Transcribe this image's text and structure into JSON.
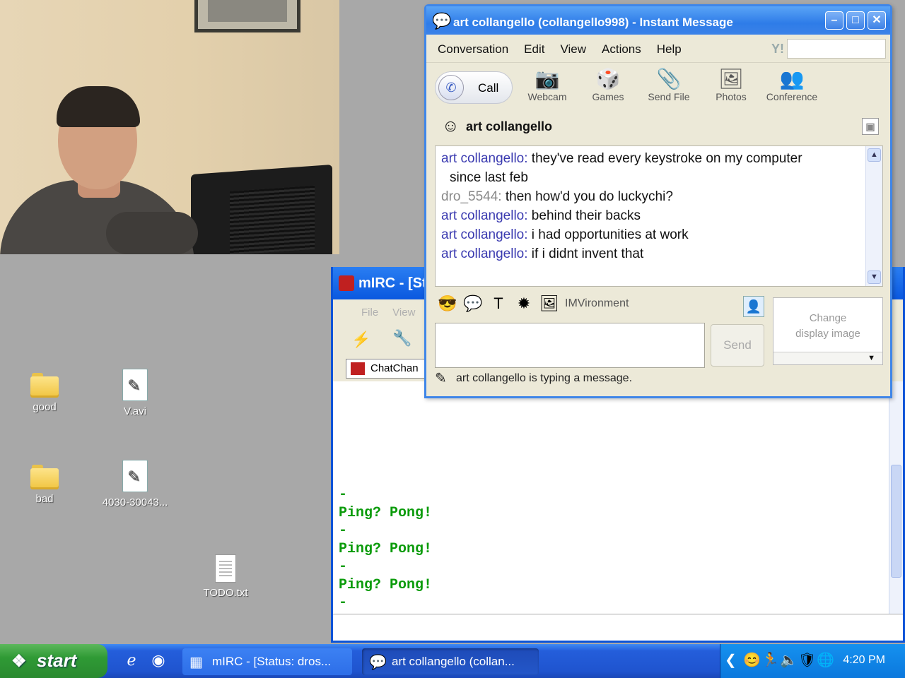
{
  "desktop": {
    "icons": [
      {
        "label": "good",
        "type": "folder"
      },
      {
        "label": "V.avi",
        "type": "video"
      },
      {
        "label": "bad",
        "type": "folder"
      },
      {
        "label": "4030-30043...",
        "type": "video"
      },
      {
        "label": "TODO.txt",
        "type": "text"
      }
    ]
  },
  "im": {
    "title": "art collangello (collangello998) - Instant Message",
    "menu": [
      "Conversation",
      "Edit",
      "View",
      "Actions",
      "Help"
    ],
    "call_label": "Call",
    "tools": [
      {
        "label": "Webcam",
        "icon": "webcam-icon"
      },
      {
        "label": "Games",
        "icon": "games-icon"
      },
      {
        "label": "Send File",
        "icon": "send-file-icon"
      },
      {
        "label": "Photos",
        "icon": "photos-icon"
      },
      {
        "label": "Conference",
        "icon": "conference-icon"
      }
    ],
    "contact_name": "art collangello",
    "messages": [
      {
        "sender": "art collangello:",
        "text": " they've read every keystroke on my computer",
        "cont": "since last feb",
        "own": false
      },
      {
        "sender": "dro_5544:",
        "text": " then how'd you do luckychi?",
        "cont": "",
        "own": true
      },
      {
        "sender": "art collangello:",
        "text": " behind their backs",
        "cont": "",
        "own": false
      },
      {
        "sender": "art collangello:",
        "text": " i had opportunities at work",
        "cont": "",
        "own": false
      },
      {
        "sender": "art collangello:",
        "text": " if i didnt invent that",
        "cont": "",
        "own": false
      }
    ],
    "imvironment_label": "IMVironment",
    "send_label": "Send",
    "display_image_label_1": "Change",
    "display_image_label_2": "display image",
    "status_text": "art collangello is typing a message."
  },
  "mirc": {
    "title": "mIRC - [St",
    "menu": [
      "File",
      "View"
    ],
    "tab_label": "ChatChan",
    "log": [
      "-",
      "Ping? Pong!",
      "-",
      "Ping? Pong!",
      "-",
      "Ping? Pong!",
      "-"
    ]
  },
  "taskbar": {
    "start_label": "start",
    "tasks": [
      {
        "label": "mIRC - [Status: dros..."
      },
      {
        "label": "art collangello (collan..."
      }
    ],
    "clock": "4:20 PM"
  },
  "colors": {
    "xp_blue": "#0a58df",
    "mirc_text_green": "#0b9b0b",
    "im_sender_blue": "#3a3ab0"
  }
}
